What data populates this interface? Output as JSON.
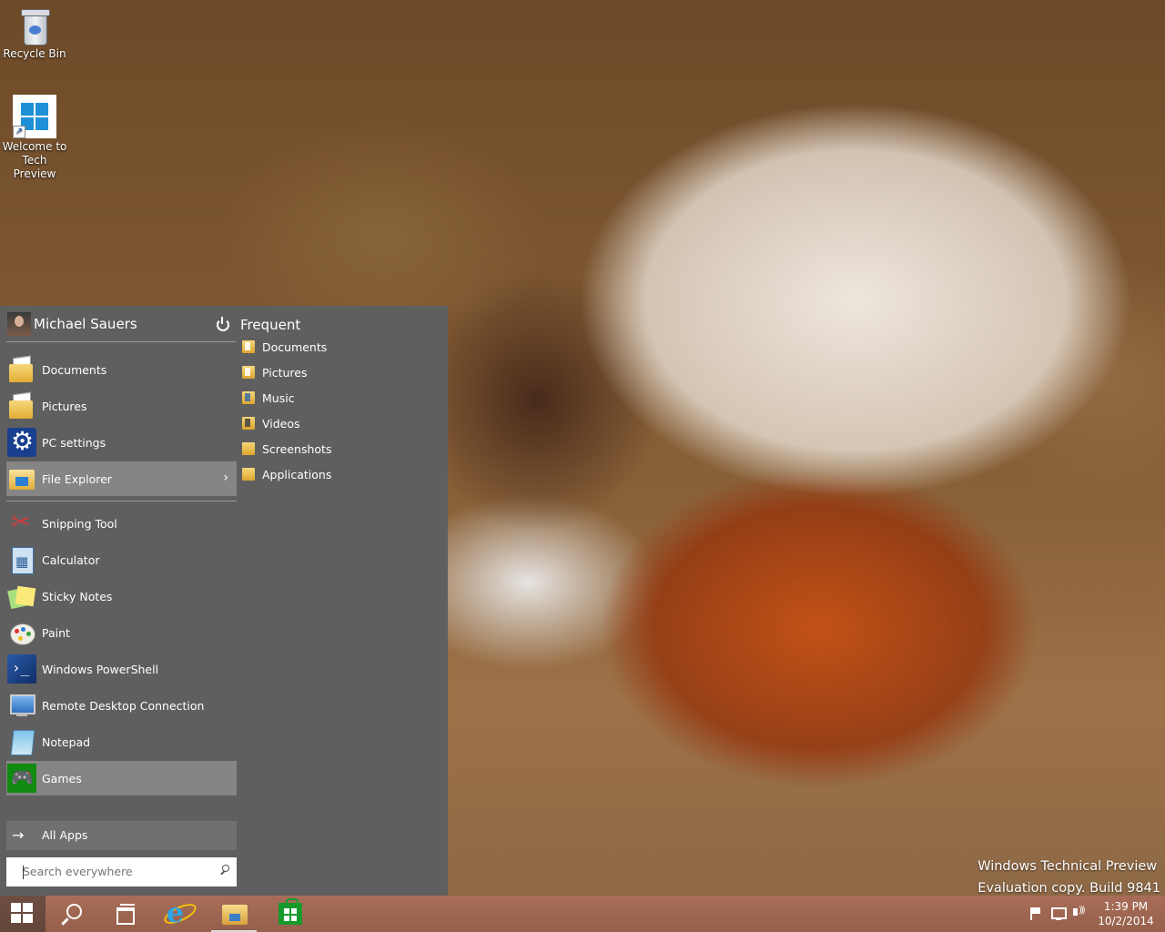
{
  "desktop": {
    "icons": [
      {
        "label": "Recycle Bin"
      },
      {
        "label_line1": "Welcome to",
        "label_line2": "Tech Preview"
      }
    ],
    "watermark": {
      "line1": "Windows Technical Preview",
      "line2": "Evaluation copy. Build 9841"
    }
  },
  "start_menu": {
    "user_name": "Michael Sauers",
    "frequent_title": "Frequent",
    "places": [
      {
        "label": "Documents",
        "icon": "documents-folder-icon"
      },
      {
        "label": "Pictures",
        "icon": "pictures-folder-icon"
      },
      {
        "label": "PC settings",
        "icon": "gear-icon"
      },
      {
        "label": "File Explorer",
        "icon": "file-explorer-icon",
        "highlighted": true,
        "has_submenu": true,
        "chevron": "›"
      }
    ],
    "apps": [
      {
        "label": "Snipping Tool",
        "icon": "scissors-icon"
      },
      {
        "label": "Calculator",
        "icon": "calculator-icon"
      },
      {
        "label": "Sticky Notes",
        "icon": "sticky-notes-icon"
      },
      {
        "label": "Paint",
        "icon": "paint-palette-icon"
      },
      {
        "label": "Windows PowerShell",
        "icon": "powershell-icon"
      },
      {
        "label": "Remote Desktop Connection",
        "icon": "remote-desktop-icon"
      },
      {
        "label": "Notepad",
        "icon": "notepad-icon"
      },
      {
        "label": "Games",
        "icon": "gamepad-icon",
        "highlighted": true
      }
    ],
    "frequent": [
      {
        "label": "Documents",
        "icon": "documents-folder-icon"
      },
      {
        "label": "Pictures",
        "icon": "pictures-folder-icon"
      },
      {
        "label": "Music",
        "icon": "music-folder-icon"
      },
      {
        "label": "Videos",
        "icon": "videos-folder-icon"
      },
      {
        "label": "Screenshots",
        "icon": "folder-icon"
      },
      {
        "label": "Applications",
        "icon": "folder-icon"
      }
    ],
    "all_apps_label": "All Apps",
    "all_apps_arrow": "→",
    "search_placeholder": "Search everywhere"
  },
  "taskbar": {
    "pinned": [
      "start-button",
      "search-button",
      "task-view-button",
      "internet-explorer-button",
      "file-explorer-button",
      "store-button"
    ],
    "ie_glyph": "e",
    "clock": {
      "time": "1:39 PM",
      "date": "10/2/2014"
    },
    "tray_icons": [
      "action-center-flag-icon",
      "network-icon",
      "volume-icon"
    ]
  },
  "colors": {
    "start_menu_bg": "#5f5f5f",
    "highlight": "#858585",
    "taskbar": "#a46e5a",
    "store_green": "#179a2c",
    "ie_blue": "#2fa4e7"
  }
}
